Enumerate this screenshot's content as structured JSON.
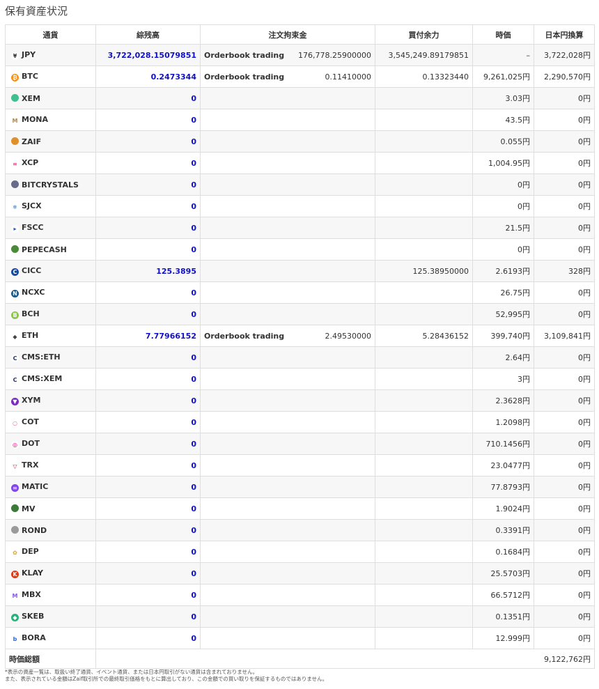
{
  "page": {
    "title": "保有資産状況"
  },
  "table": {
    "headers": {
      "currency": "通貨",
      "balance": "綜残高",
      "order_locked": "注文拘束金",
      "available": "買付余力",
      "price": "時価",
      "jpy_value": "日本円換算"
    },
    "rows": [
      {
        "name": "JPY",
        "icon": "yen-icon",
        "color": "#ffffff",
        "glyph": "¥",
        "glyph_color": "#333333",
        "balance": "3,722,028.15079851",
        "order_label": "Orderbook trading",
        "order_amount": "176,778.25900000",
        "available": "3,545,249.89179851",
        "price": "–",
        "jpy_value": "3,722,028円"
      },
      {
        "name": "BTC",
        "icon": "bitcoin-icon",
        "color": "#f7931a",
        "glyph": "₿",
        "glyph_color": "#ffffff",
        "balance": "0.2473344",
        "order_label": "Orderbook trading",
        "order_amount": "0.11410000",
        "available": "0.13323440",
        "price": "9,261,025円",
        "jpy_value": "2,290,570円"
      },
      {
        "name": "XEM",
        "icon": "xem-icon",
        "color": "#41bf8f",
        "glyph": "",
        "glyph_color": "#ffffff",
        "balance": "0",
        "order_label": "",
        "order_amount": "",
        "available": "",
        "price": "3.03円",
        "jpy_value": "0円"
      },
      {
        "name": "MONA",
        "icon": "monacoin-icon",
        "color": "#ffffff",
        "glyph": "M",
        "glyph_color": "#b08a55",
        "balance": "0",
        "order_label": "",
        "order_amount": "",
        "available": "",
        "price": "43.5円",
        "jpy_value": "0円"
      },
      {
        "name": "ZAIF",
        "icon": "zaif-icon",
        "color": "#e0902a",
        "glyph": "",
        "glyph_color": "#ffffff",
        "balance": "0",
        "order_label": "",
        "order_amount": "",
        "available": "",
        "price": "0.055円",
        "jpy_value": "0円"
      },
      {
        "name": "XCP",
        "icon": "counterparty-icon",
        "color": "#ffffff",
        "glyph": "∞",
        "glyph_color": "#e0306a",
        "balance": "0",
        "order_label": "",
        "order_amount": "",
        "available": "",
        "price": "1,004.95円",
        "jpy_value": "0円"
      },
      {
        "name": "BITCRYSTALS",
        "icon": "bitcrystals-icon",
        "color": "#6a6a8a",
        "glyph": "",
        "glyph_color": "#ffffff",
        "balance": "0",
        "order_label": "",
        "order_amount": "",
        "available": "",
        "price": "0円",
        "jpy_value": "0円"
      },
      {
        "name": "SJCX",
        "icon": "sjcx-icon",
        "color": "#ffffff",
        "glyph": "❄",
        "glyph_color": "#2a8ae0",
        "balance": "0",
        "order_label": "",
        "order_amount": "",
        "available": "",
        "price": "0円",
        "jpy_value": "0円"
      },
      {
        "name": "FSCC",
        "icon": "fscc-icon",
        "color": "#ffffff",
        "glyph": "▸",
        "glyph_color": "#2050c0",
        "balance": "0",
        "order_label": "",
        "order_amount": "",
        "available": "",
        "price": "21.5円",
        "jpy_value": "0円"
      },
      {
        "name": "PEPECASH",
        "icon": "pepecash-icon",
        "color": "#4a8a3a",
        "glyph": "",
        "glyph_color": "#ffffff",
        "balance": "0",
        "order_label": "",
        "order_amount": "",
        "available": "",
        "price": "0円",
        "jpy_value": "0円"
      },
      {
        "name": "CICC",
        "icon": "cicc-icon",
        "color": "#1a4aa0",
        "glyph": "C",
        "glyph_color": "#ffffff",
        "balance": "125.3895",
        "order_label": "",
        "order_amount": "",
        "available": "125.38950000",
        "price": "2.6193円",
        "jpy_value": "328円"
      },
      {
        "name": "NCXC",
        "icon": "ncxc-icon",
        "color": "#1a5a8a",
        "glyph": "N",
        "glyph_color": "#ffffff",
        "balance": "0",
        "order_label": "",
        "order_amount": "",
        "available": "",
        "price": "26.75円",
        "jpy_value": "0円"
      },
      {
        "name": "BCH",
        "icon": "bitcoin-cash-icon",
        "color": "#8dc351",
        "glyph": "B",
        "glyph_color": "#ffffff",
        "balance": "0",
        "order_label": "",
        "order_amount": "",
        "available": "",
        "price": "52,995円",
        "jpy_value": "0円"
      },
      {
        "name": "ETH",
        "icon": "ethereum-icon",
        "color": "#ffffff",
        "glyph": "◆",
        "glyph_color": "#444444",
        "balance": "7.77966152",
        "order_label": "Orderbook trading",
        "order_amount": "2.49530000",
        "available": "5.28436152",
        "price": "399,740円",
        "jpy_value": "3,109,841円"
      },
      {
        "name": "CMS:ETH",
        "icon": "cms-eth-icon",
        "color": "#ffffff",
        "glyph": "C",
        "glyph_color": "#22336a",
        "balance": "0",
        "order_label": "",
        "order_amount": "",
        "available": "",
        "price": "2.64円",
        "jpy_value": "0円"
      },
      {
        "name": "CMS:XEM",
        "icon": "cms-xem-icon",
        "color": "#ffffff",
        "glyph": "C",
        "glyph_color": "#22336a",
        "balance": "0",
        "order_label": "",
        "order_amount": "",
        "available": "",
        "price": "3円",
        "jpy_value": "0円"
      },
      {
        "name": "XYM",
        "icon": "symbol-icon",
        "color": "#7b2cbf",
        "glyph": "▼",
        "glyph_color": "#ffffff",
        "balance": "0",
        "order_label": "",
        "order_amount": "",
        "available": "",
        "price": "2.3628円",
        "jpy_value": "0円"
      },
      {
        "name": "COT",
        "icon": "cot-icon",
        "color": "#ffffff",
        "glyph": "○",
        "glyph_color": "#e07090",
        "balance": "0",
        "order_label": "",
        "order_amount": "",
        "available": "",
        "price": "1.2098円",
        "jpy_value": "0円"
      },
      {
        "name": "DOT",
        "icon": "polkadot-icon",
        "color": "#ffffff",
        "glyph": "◎",
        "glyph_color": "#e6007a",
        "balance": "0",
        "order_label": "",
        "order_amount": "",
        "available": "",
        "price": "710.1456円",
        "jpy_value": "0円"
      },
      {
        "name": "TRX",
        "icon": "tron-icon",
        "color": "#ffffff",
        "glyph": "▽",
        "glyph_color": "#e0182d",
        "balance": "0",
        "order_label": "",
        "order_amount": "",
        "available": "",
        "price": "23.0477円",
        "jpy_value": "0円"
      },
      {
        "name": "MATIC",
        "icon": "polygon-icon",
        "color": "#8247e5",
        "glyph": "∞",
        "glyph_color": "#ffffff",
        "balance": "0",
        "order_label": "",
        "order_amount": "",
        "available": "",
        "price": "77.8793円",
        "jpy_value": "0円"
      },
      {
        "name": "MV",
        "icon": "mv-icon",
        "color": "#3a7a3a",
        "glyph": "",
        "glyph_color": "#ffffff",
        "balance": "0",
        "order_label": "",
        "order_amount": "",
        "available": "",
        "price": "1.9024円",
        "jpy_value": "0円"
      },
      {
        "name": "ROND",
        "icon": "rond-icon",
        "color": "#9a9a9a",
        "glyph": "",
        "glyph_color": "#ffffff",
        "balance": "0",
        "order_label": "",
        "order_amount": "",
        "available": "",
        "price": "0.3391円",
        "jpy_value": "0円"
      },
      {
        "name": "DEP",
        "icon": "dep-icon",
        "color": "#ffffff",
        "glyph": "✿",
        "glyph_color": "#e0a020",
        "balance": "0",
        "order_label": "",
        "order_amount": "",
        "available": "",
        "price": "0.1684円",
        "jpy_value": "0円"
      },
      {
        "name": "KLAY",
        "icon": "klaytn-icon",
        "color": "#e03a1a",
        "glyph": "K",
        "glyph_color": "#ffffff",
        "balance": "0",
        "order_label": "",
        "order_amount": "",
        "available": "",
        "price": "25.5703円",
        "jpy_value": "0円"
      },
      {
        "name": "MBX",
        "icon": "mbx-icon",
        "color": "#ffffff",
        "glyph": "M",
        "glyph_color": "#8a5ae0",
        "balance": "0",
        "order_label": "",
        "order_amount": "",
        "available": "",
        "price": "66.5712円",
        "jpy_value": "0円"
      },
      {
        "name": "SKEB",
        "icon": "skeb-icon",
        "color": "#2ab07a",
        "glyph": "◆",
        "glyph_color": "#ffffff",
        "balance": "0",
        "order_label": "",
        "order_amount": "",
        "available": "",
        "price": "0.1351円",
        "jpy_value": "0円"
      },
      {
        "name": "BORA",
        "icon": "bora-icon",
        "color": "#ffffff",
        "glyph": "b",
        "glyph_color": "#2a6ae0",
        "balance": "0",
        "order_label": "",
        "order_amount": "",
        "available": "",
        "price": "12.999円",
        "jpy_value": "0円"
      }
    ],
    "footer": {
      "label": "時価総額",
      "value": "9,122,762円"
    }
  },
  "notes": [
    "*表示の資産一覧は、取扱い終了通貨、イベント通貨、または日本円取引がない通貨は含まれておりません。",
    "また、表示されている金額はZaif取引所での最終取引価格をもとに算出しており、この金額での買い取りを保証するものではありません。"
  ]
}
